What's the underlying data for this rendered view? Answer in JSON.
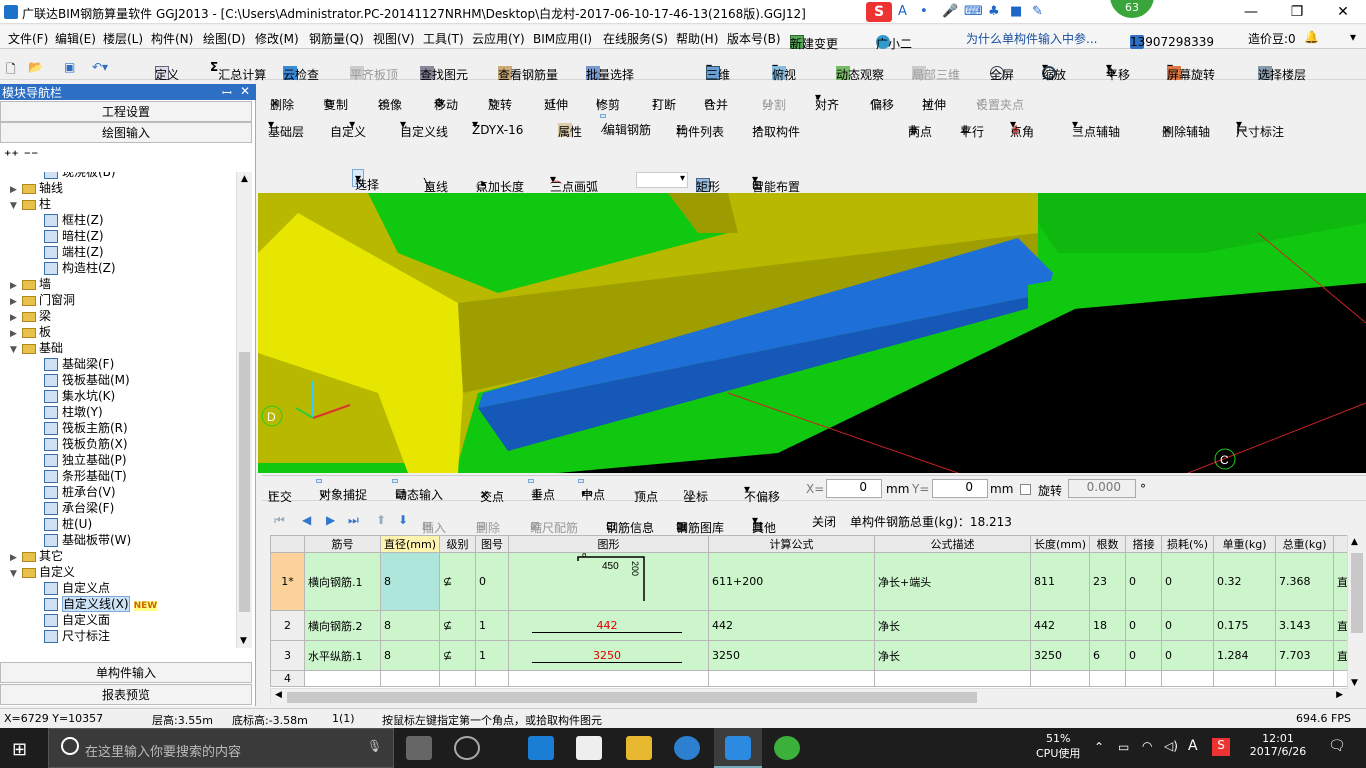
{
  "window": {
    "title": "广联达BIM钢筋算量软件 GGJ2013 - [C:\\Users\\Administrator.PC-20141127NRHM\\Desktop\\白龙村-2017-06-10-17-46-13(2168版).GGJ12]",
    "badge": "63",
    "minimize": "—",
    "restore": "❐",
    "close": "✕"
  },
  "menu": [
    "文件(F)",
    "编辑(E)",
    "楼层(L)",
    "构件(N)",
    "绘图(D)",
    "修改(M)",
    "钢筋量(Q)",
    "视图(V)",
    "工具(T)",
    "云应用(Y)",
    "BIM应用(I)",
    "在线服务(S)",
    "帮助(H)",
    "版本号(B)",
    "新建变更",
    "广小二",
    "为什么单构件输入中参...",
    "13907298339",
    "造价豆:0"
  ],
  "toolbar1": [
    "定义",
    "汇总计算",
    "云检查",
    "平齐板顶",
    "查找图元",
    "查看钢筋量",
    "批量选择",
    "三维",
    "俯视",
    "动态观察",
    "局部三维",
    "全屏",
    "缩放",
    "平移",
    "屏幕旋转",
    "选择楼层"
  ],
  "toolbar2": [
    "删除",
    "复制",
    "镜像",
    "移动",
    "旋转",
    "延伸",
    "修剪",
    "打断",
    "合并",
    "分割",
    "对齐",
    "偏移",
    "拉伸",
    "设置夹点"
  ],
  "toolbar3": {
    "layer": "基础层",
    "def1": "自定义",
    "def2": "自定义线",
    "code": "ZDYX-16",
    "items": [
      "属性",
      "编辑钢筋",
      "构件列表",
      "拾取构件"
    ],
    "right": [
      "两点",
      "平行",
      "点角",
      "三点辅轴",
      "删除辅轴",
      "尺寸标注"
    ]
  },
  "toolbar4": [
    "选择",
    "直线",
    "点加长度",
    "三点画弧",
    "矩形",
    "智能布置"
  ],
  "leftpanel": {
    "header": "模块导航栏",
    "pin": "ꟷ",
    "close": "✕",
    "btn1": "工程设置",
    "btn2": "绘图输入",
    "btn3": "单构件输入",
    "btn4": "报表预览",
    "tree": [
      {
        "t": "现浇板(B)",
        "lvl": 2,
        "kind": "c"
      },
      {
        "t": "轴线",
        "lvl": 1,
        "kind": "f",
        "exp": "▶"
      },
      {
        "t": "柱",
        "lvl": 1,
        "kind": "f",
        "exp": "▼"
      },
      {
        "t": "框柱(Z)",
        "lvl": 2,
        "kind": "c"
      },
      {
        "t": "暗柱(Z)",
        "lvl": 2,
        "kind": "c"
      },
      {
        "t": "端柱(Z)",
        "lvl": 2,
        "kind": "c"
      },
      {
        "t": "构造柱(Z)",
        "lvl": 2,
        "kind": "c"
      },
      {
        "t": "墙",
        "lvl": 1,
        "kind": "f",
        "exp": "▶"
      },
      {
        "t": "门窗洞",
        "lvl": 1,
        "kind": "f",
        "exp": "▶"
      },
      {
        "t": "梁",
        "lvl": 1,
        "kind": "f",
        "exp": "▶"
      },
      {
        "t": "板",
        "lvl": 1,
        "kind": "f",
        "exp": "▶"
      },
      {
        "t": "基础",
        "lvl": 1,
        "kind": "f",
        "exp": "▼"
      },
      {
        "t": "基础梁(F)",
        "lvl": 2,
        "kind": "c"
      },
      {
        "t": "筏板基础(M)",
        "lvl": 2,
        "kind": "c"
      },
      {
        "t": "集水坑(K)",
        "lvl": 2,
        "kind": "c"
      },
      {
        "t": "柱墩(Y)",
        "lvl": 2,
        "kind": "c"
      },
      {
        "t": "筏板主筋(R)",
        "lvl": 2,
        "kind": "c"
      },
      {
        "t": "筏板负筋(X)",
        "lvl": 2,
        "kind": "c"
      },
      {
        "t": "独立基础(P)",
        "lvl": 2,
        "kind": "c"
      },
      {
        "t": "条形基础(T)",
        "lvl": 2,
        "kind": "c"
      },
      {
        "t": "桩承台(V)",
        "lvl": 2,
        "kind": "c"
      },
      {
        "t": "承台梁(F)",
        "lvl": 2,
        "kind": "c"
      },
      {
        "t": "桩(U)",
        "lvl": 2,
        "kind": "c"
      },
      {
        "t": "基础板带(W)",
        "lvl": 2,
        "kind": "c"
      },
      {
        "t": "其它",
        "lvl": 1,
        "kind": "f",
        "exp": "▶"
      },
      {
        "t": "自定义",
        "lvl": 1,
        "kind": "f",
        "exp": "▼"
      },
      {
        "t": "自定义点",
        "lvl": 2,
        "kind": "c"
      },
      {
        "t": "自定义线(X)",
        "lvl": 2,
        "kind": "c",
        "sel": true,
        "new": "NEW"
      },
      {
        "t": "自定义面",
        "lvl": 2,
        "kind": "c"
      },
      {
        "t": "尺寸标注",
        "lvl": 2,
        "kind": "c"
      }
    ]
  },
  "viewport": {
    "axisD": "D",
    "axisC": "C"
  },
  "snapbar": {
    "items": [
      "正交",
      "对象捕捉",
      "动态输入",
      "交点",
      "垂点",
      "中点",
      "顶点",
      "坐标"
    ],
    "offset": "不偏移",
    "x_label": "X=",
    "x": "0",
    "mm1": "mm",
    "y_label": "Y=",
    "y": "0",
    "mm2": "mm",
    "rotate": "旋转",
    "rotate_val": "0.000",
    "deg": "°"
  },
  "gridbar": {
    "items": [
      "插入",
      "删除",
      "缩尺配筋",
      "钢筋信息",
      "钢筋图库",
      "其他",
      "关闭"
    ],
    "total": "单构件钢筋总重(kg)：18.213"
  },
  "grid": {
    "headers": [
      "筋号",
      "直径(mm)",
      "级别",
      "图号",
      "图形",
      "计算公式",
      "公式描述",
      "长度(mm)",
      "根数",
      "搭接",
      "损耗(%)",
      "单重(kg)",
      "总重(kg)",
      ""
    ],
    "rows": [
      {
        "idx": "1*",
        "c": [
          "横向钢筋.1",
          "8",
          "⊈",
          "0",
          "",
          "611+200",
          "净长+端头",
          "811",
          "23",
          "0",
          "0",
          "0.32",
          "7.368",
          "直"
        ],
        "shape": {
          "a": "450",
          "b": "200",
          "c": "8"
        }
      },
      {
        "idx": "2",
        "c": [
          "横向钢筋.2",
          "8",
          "⊈",
          "1",
          "442",
          "442",
          "净长",
          "442",
          "18",
          "0",
          "0",
          "0.175",
          "3.143",
          "直"
        ]
      },
      {
        "idx": "3",
        "c": [
          "水平纵筋.1",
          "8",
          "⊈",
          "1",
          "3250",
          "3250",
          "净长",
          "3250",
          "6",
          "0",
          "0",
          "1.284",
          "7.703",
          "直"
        ]
      },
      {
        "idx": "4",
        "c": [
          "",
          "",
          "",
          "",
          "",
          "",
          "",
          "",
          "",
          "",
          "",
          "",
          "",
          ""
        ]
      }
    ]
  },
  "status": {
    "coord": "X=6729 Y=10357",
    "floor_h": "层高:3.55m",
    "bottom_h": "底标高:-3.58m",
    "count": "1(1)",
    "hint": "按鼠标左键指定第一个角点，或拾取构件图元",
    "fps": "694.6 FPS"
  },
  "taskbar": {
    "search": "在这里输入你要搜索的内容",
    "cpu": "51%",
    "cpu_label": "CPU使用",
    "ime": "A",
    "time": "12:01",
    "date": "2017/6/26"
  },
  "colors": {
    "accent": "#2d6fc4",
    "slab_yellow": "#b8b800",
    "slab_green": "#11c811",
    "beam_blue": "#1f6fd8",
    "grid_green": "#ccf5cc"
  }
}
